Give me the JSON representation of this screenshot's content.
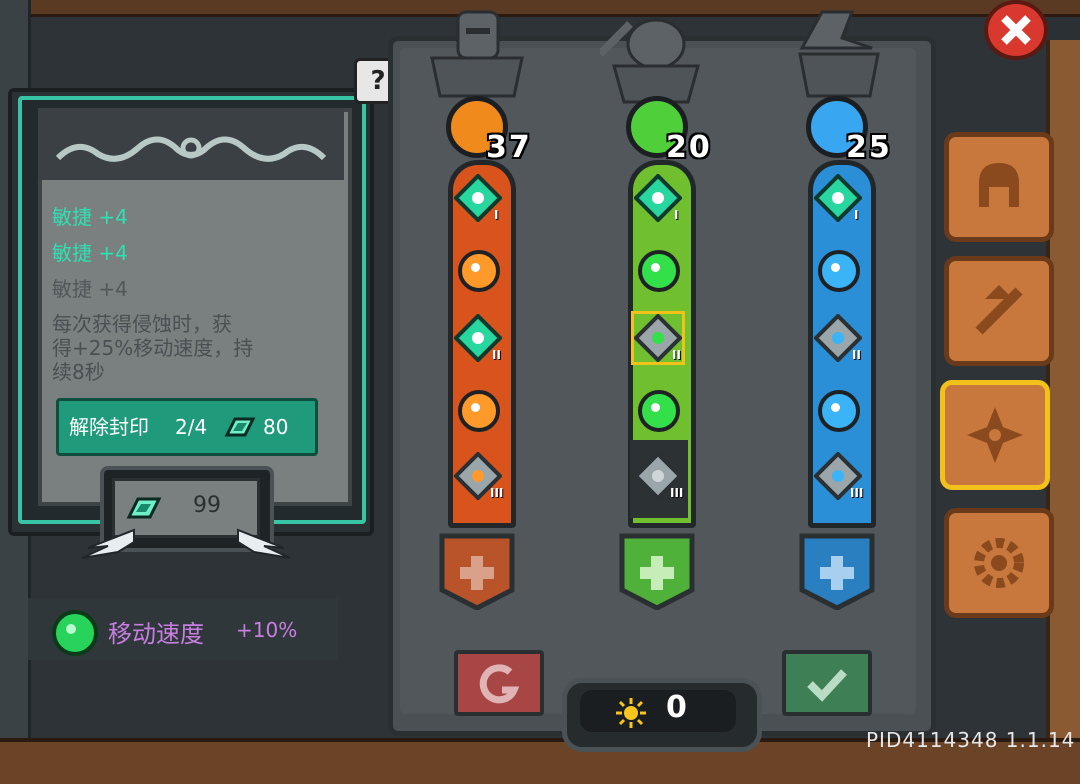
{
  "tooltip": {
    "stats": [
      "敏捷 +4",
      "敏捷 +4",
      "敏捷 +4"
    ],
    "description_lines": [
      "每次获得侵蚀时，获",
      "得+25%移动速度，持",
      "续8秒"
    ],
    "unseal_button": {
      "label": "解除封印",
      "progress": "2/4",
      "cost": "80"
    },
    "gem_balance": "99"
  },
  "bonus": {
    "label": "移动速度",
    "value": "+10%"
  },
  "help_label": "?",
  "trees": [
    {
      "name": "red",
      "icon": "fist-icon",
      "count": "37",
      "color": "#d9531c"
    },
    {
      "name": "green",
      "icon": "leaf-icon",
      "count": "20",
      "color": "#6fbf2f"
    },
    {
      "name": "blue",
      "icon": "book-icon",
      "count": "25",
      "color": "#2a8fd6"
    }
  ],
  "roman_numerals": [
    "I",
    "II",
    "III"
  ],
  "points": "0",
  "side_tabs": [
    "helmet-icon",
    "weapon-upgrade-icon",
    "rune-icon",
    "settings-gear-icon"
  ],
  "version": "PID4114348 1.1.14",
  "colors": {
    "teal": "#38c5a5",
    "red": "#d9531c",
    "green": "#6fbf2f",
    "blue": "#2a8fd6",
    "accent_yellow": "#f2c21a"
  }
}
